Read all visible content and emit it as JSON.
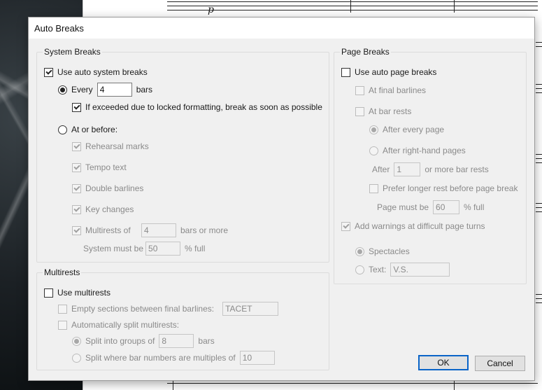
{
  "dialog": {
    "title": "Auto Breaks"
  },
  "system_breaks": {
    "title": "System Breaks",
    "use_auto_label": "Use auto system breaks",
    "every_label": "Every",
    "every_value": "4",
    "bars_label": "bars",
    "locked_label": "If exceeded due to locked formatting, break as soon as possible",
    "at_or_before_label": "At or before:",
    "rehearsal_label": "Rehearsal marks",
    "tempo_label": "Tempo text",
    "double_barlines_label": "Double barlines",
    "key_changes_label": "Key changes",
    "multirests_label": "Multirests of",
    "multirests_value": "4",
    "bars_or_more_label": "bars or more",
    "system_must_be_label": "System must be",
    "system_must_be_value": "50",
    "percent_full_label": "% full"
  },
  "multirests": {
    "title": "Multirests",
    "use_label": "Use multirests",
    "empty_sections_label": "Empty sections between final barlines:",
    "empty_sections_value": "TACET",
    "auto_split_label": "Automatically split multirests:",
    "split_groups_label": "Split into groups of",
    "split_groups_value": "8",
    "split_groups_bars": "bars",
    "split_multiples_label": "Split where bar numbers are multiples of",
    "split_multiples_value": "10"
  },
  "page_breaks": {
    "title": "Page Breaks",
    "use_auto_label": "Use auto page breaks",
    "final_barlines_label": "At final barlines",
    "bar_rests_label": "At bar rests",
    "after_every_page_label": "After every page",
    "after_right_hand_label": "After right-hand pages",
    "after_label": "After",
    "after_value": "1",
    "more_bar_rests_label": "or more bar rests",
    "prefer_longer_label": "Prefer longer rest before page break",
    "page_must_be_label": "Page must be",
    "page_must_be_value": "60",
    "percent_full_label": "% full",
    "warnings_label": "Add warnings at difficult page turns",
    "spectacles_label": "Spectacles",
    "text_label": "Text:",
    "text_value": "V.S."
  },
  "buttons": {
    "ok": "OK",
    "cancel": "Cancel"
  },
  "background": {
    "dynamic_mark": "p"
  }
}
